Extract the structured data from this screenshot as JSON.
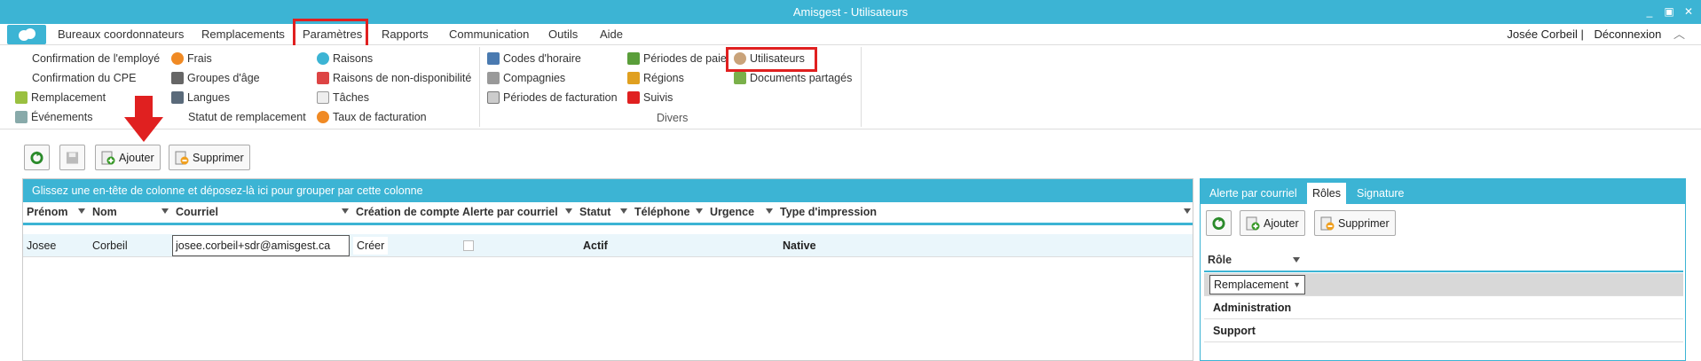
{
  "window": {
    "title": "Amisgest - Utilisateurs",
    "controls": [
      "_",
      "▣",
      "✕"
    ]
  },
  "menu": {
    "items": [
      "Bureaux coordonnateurs",
      "Remplacements",
      "Paramètres",
      "Rapports",
      "Communication",
      "Outils",
      "Aide"
    ],
    "user": "Josée Corbeil |",
    "logout": "Déconnexion"
  },
  "ribbon": {
    "col1": [
      "Confirmation de l'employé",
      "Confirmation du CPE",
      "Remplacement",
      "Événements"
    ],
    "col2": [
      "Frais",
      "Groupes d'âge",
      "Langues",
      "Statut de remplacement"
    ],
    "col3": [
      "Raisons",
      "Raisons de non-disponibilité",
      "Tâches",
      "Taux de facturation"
    ],
    "col4": [
      "Codes d'horaire",
      "Compagnies",
      "Périodes de facturation"
    ],
    "col5": [
      "Périodes de paie",
      "Régions",
      "Suivis"
    ],
    "col6": [
      "Utilisateurs",
      "Documents partagés"
    ],
    "group_label": "Divers"
  },
  "toolbar": {
    "add": "Ajouter",
    "delete": "Supprimer"
  },
  "grid": {
    "group_hint": "Glissez une en-tête de colonne et déposez-là ici pour grouper par cette colonne",
    "columns": [
      "Prénom",
      "Nom",
      "Courriel",
      "Création de compte",
      "Alerte par courriel",
      "Statut",
      "Téléphone",
      "Urgence",
      "Type d'impression"
    ],
    "rows": [
      {
        "prenom": "Josee",
        "nom": "Corbeil",
        "courriel": "josee.corbeil+sdr@amisgest.ca",
        "creation": "Créer",
        "statut": "Actif",
        "impression": "Native"
      }
    ]
  },
  "right_panel": {
    "tabs": [
      "Alerte par courriel",
      "Rôles",
      "Signature"
    ],
    "add": "Ajouter",
    "delete": "Supprimer",
    "role_column": "Rôle",
    "roles": [
      "Remplacement",
      "Administration",
      "Support"
    ]
  },
  "colors": {
    "accent": "#3cb4d4",
    "highlight": "#e02020"
  }
}
